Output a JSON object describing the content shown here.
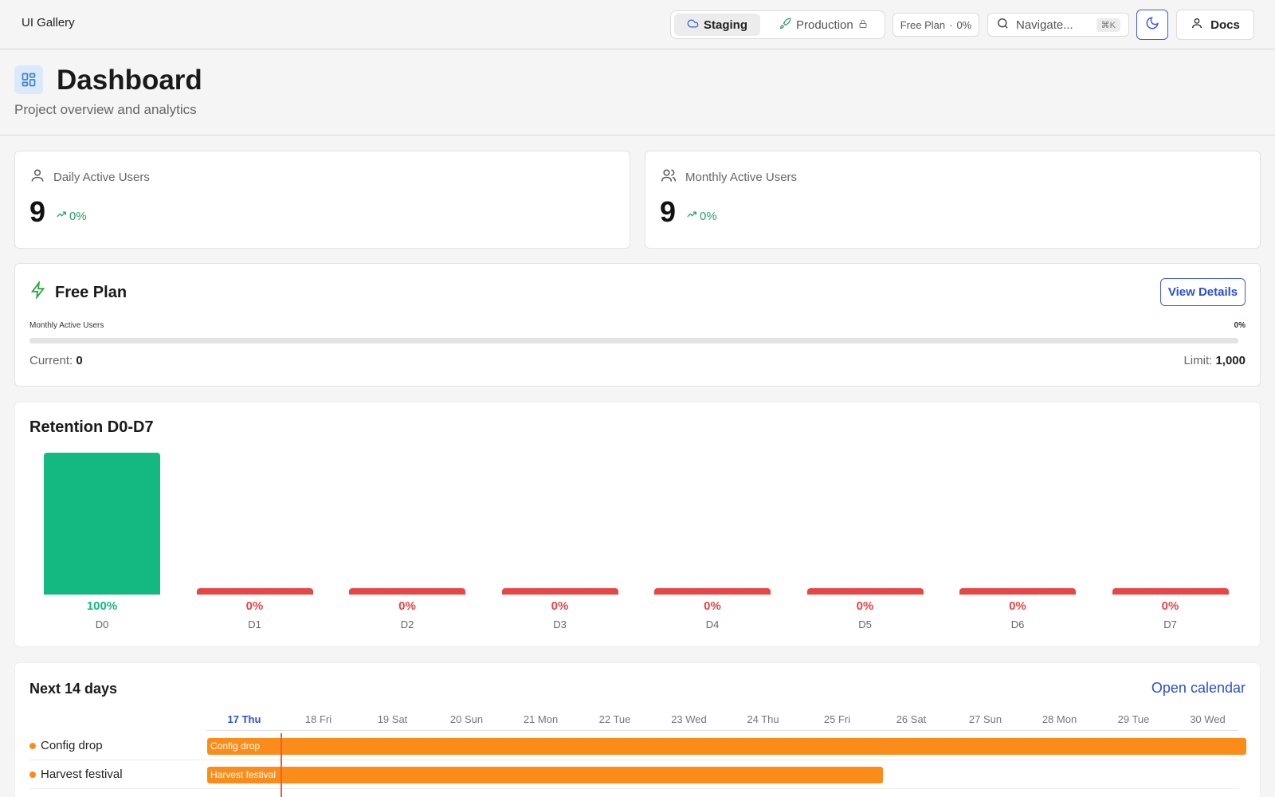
{
  "header": {
    "brand": "UI Gallery",
    "env": {
      "staging": "Staging",
      "production": "Production"
    },
    "plan_pill": {
      "plan": "Free Plan",
      "sep": "·",
      "pct": "0%"
    },
    "search": {
      "placeholder": "Navigate...",
      "shortcut": "⌘K"
    },
    "docs_label": "Docs"
  },
  "page": {
    "title": "Dashboard",
    "subtitle": "Project overview and analytics"
  },
  "stats": [
    {
      "label": "Daily Active Users",
      "value": "9",
      "trend": "0%"
    },
    {
      "label": "Monthly Active Users",
      "value": "9",
      "trend": "0%"
    }
  ],
  "plan": {
    "title": "Free Plan",
    "view_label": "View Details",
    "meter_label": "Monthly Active Users",
    "meter_pct": "0%",
    "meter_fraction": 0,
    "current_label": "Current:",
    "current_value": "0",
    "limit_label": "Limit:",
    "limit_value": "1,000"
  },
  "retention": {
    "title": "Retention D0-D7"
  },
  "chart_data": {
    "type": "bar",
    "title": "Retention D0-D7",
    "categories": [
      "D0",
      "D1",
      "D2",
      "D3",
      "D4",
      "D5",
      "D6",
      "D7"
    ],
    "values": [
      100,
      0,
      0,
      0,
      0,
      0,
      0,
      0
    ],
    "value_labels": [
      "100%",
      "0%",
      "0%",
      "0%",
      "0%",
      "0%",
      "0%",
      "0%"
    ],
    "ylim": [
      0,
      100
    ],
    "colors": {
      "positive": "#13b981",
      "zero": "#e84545"
    }
  },
  "calendar": {
    "title": "Next 14 days",
    "link_label": "Open calendar",
    "days": [
      "17 Thu",
      "18 Fri",
      "19 Sat",
      "20 Sun",
      "21 Mon",
      "22 Tue",
      "23 Wed",
      "24 Thu",
      "25 Fri",
      "26 Sat",
      "27 Sun",
      "28 Mon",
      "29 Tue",
      "30 Wed"
    ],
    "events": [
      {
        "name": "Config drop",
        "bar_label": "Config drop",
        "start_day": 0,
        "end_day": 14
      },
      {
        "name": "Harvest festival",
        "bar_label": "Harvest festival",
        "start_day": 0,
        "end_day": 9.1
      }
    ]
  },
  "colors": {
    "accent": "#3b5bdb",
    "event": "#fb8c1a",
    "today_line": "#f05b3a",
    "trend": "#2a9d68"
  }
}
